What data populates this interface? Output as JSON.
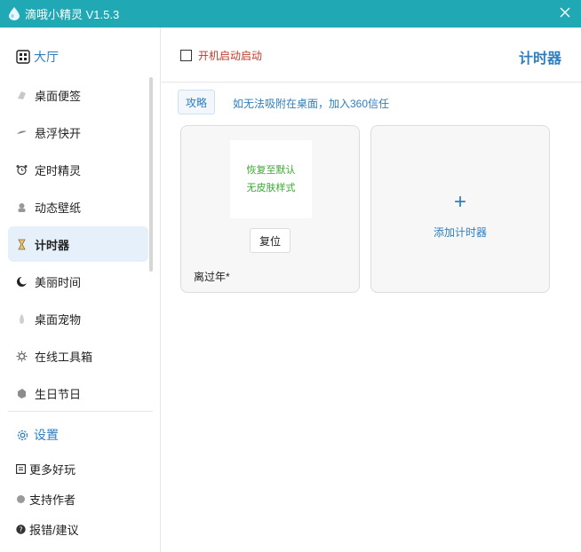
{
  "window": {
    "title": "滴哦小精灵 V1.5.3",
    "accent_color": "#20a9b4"
  },
  "sidebar": {
    "hall_label": "大厅",
    "items": [
      {
        "label": "桌面便签",
        "icon": "note-icon"
      },
      {
        "label": "悬浮快开",
        "icon": "float-icon"
      },
      {
        "label": "定时精灵",
        "icon": "alarm-clock-icon"
      },
      {
        "label": "动态壁纸",
        "icon": "wallpaper-icon"
      },
      {
        "label": "计时器",
        "icon": "hourglass-icon",
        "active": true
      },
      {
        "label": "美丽时间",
        "icon": "moon-icon"
      },
      {
        "label": "桌面宠物",
        "icon": "pet-icon"
      },
      {
        "label": "在线工具箱",
        "icon": "toolbox-icon"
      },
      {
        "label": "生日节日",
        "icon": "gift-icon"
      }
    ],
    "settings_label": "设置",
    "more_label": "更多好玩",
    "support_label": "支持作者",
    "feedback_label": "报错/建议"
  },
  "main": {
    "autostart_label": "开机启动启动",
    "autostart_checked": false,
    "page_title": "计时器",
    "guide_button": "攻略",
    "tip_text": "如无法吸附在桌面，加入360信任",
    "timer_card": {
      "preview_line1": "恢复至默认",
      "preview_line2": "无皮肤样式",
      "reset_button": "复位",
      "name": "离过年*"
    },
    "add_card": {
      "plus": "+",
      "label": "添加计时器"
    }
  }
}
